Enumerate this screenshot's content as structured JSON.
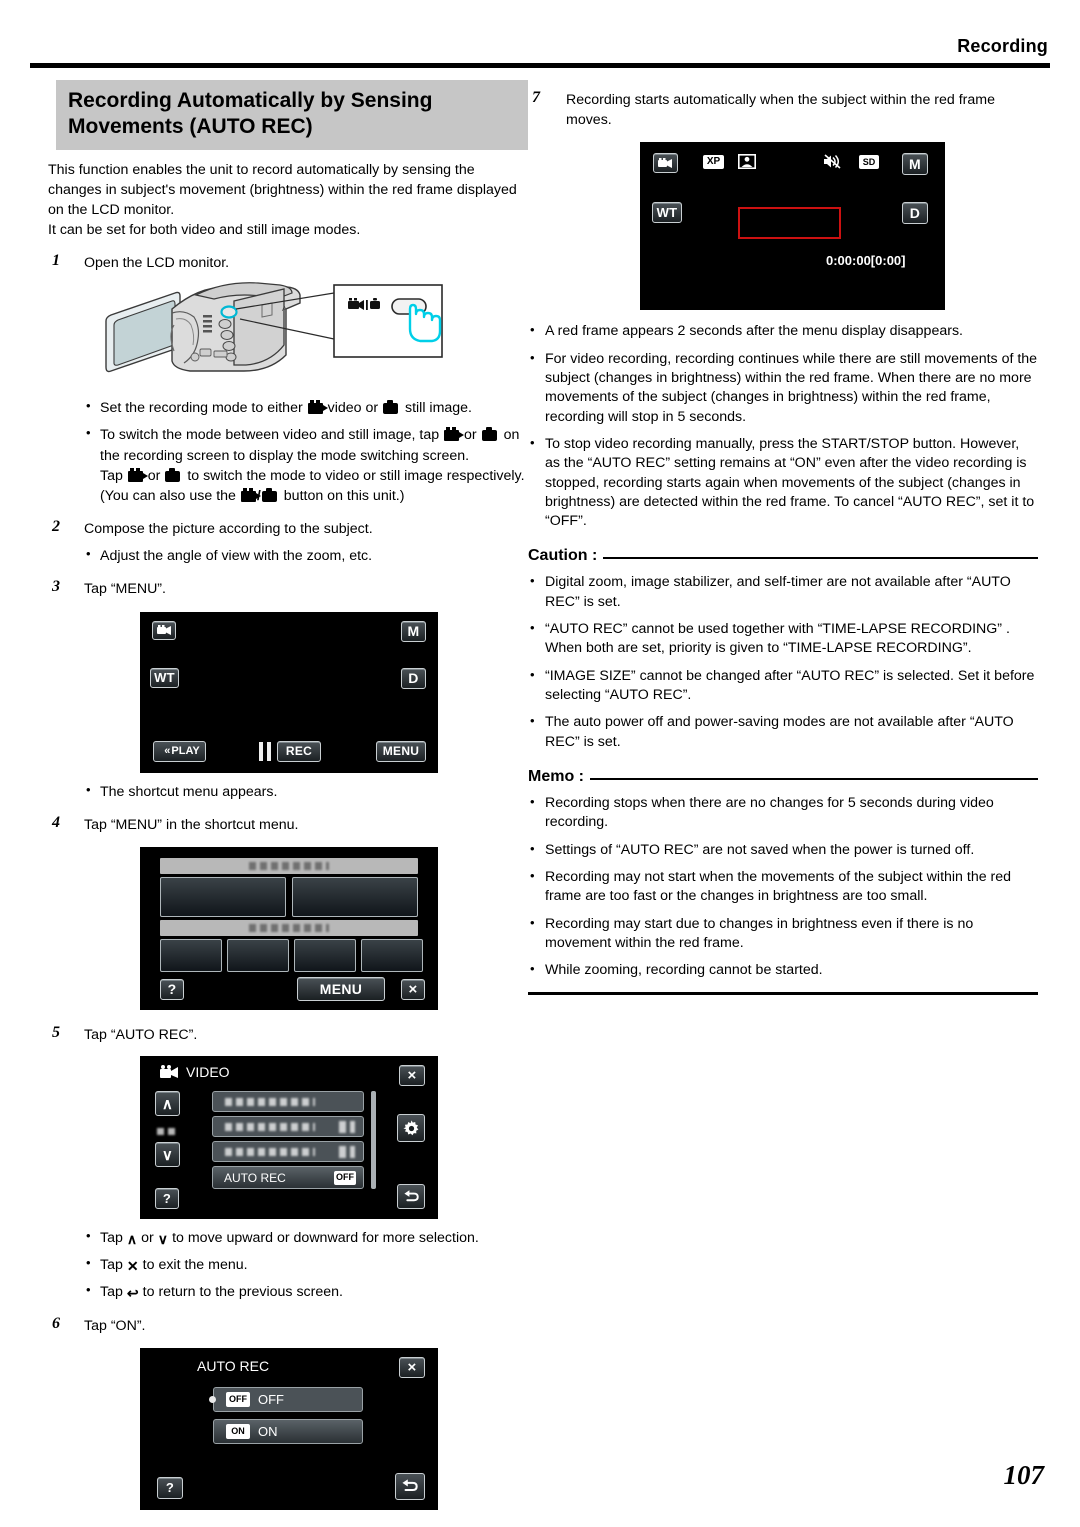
{
  "header": {
    "title": "Recording"
  },
  "page_number": "107",
  "section": {
    "title": "Recording Automatically by Sensing Movements (AUTO REC)",
    "intro_1": "This function enables the unit to record automatically by sensing the changes in subject's movement (brightness) within the red frame displayed on the LCD monitor.",
    "intro_2": "It can be set for both video and still image modes."
  },
  "steps": {
    "s1": {
      "num": "1",
      "text": "Open the LCD monitor."
    },
    "s2": {
      "num": "2",
      "text": "Compose the picture according to the subject."
    },
    "s3": {
      "num": "3",
      "text": "Tap “MENU”."
    },
    "s4": {
      "num": "4",
      "text": "Tap “MENU” in the shortcut menu."
    },
    "s5": {
      "num": "5",
      "text": "Tap “AUTO REC”."
    },
    "s6": {
      "num": "6",
      "text": "Tap “ON”."
    },
    "s7": {
      "num": "7",
      "text": "Recording starts automatically when the subject within the red frame moves."
    }
  },
  "bullets": {
    "b1_a": "Set the recording mode to either",
    "b1_b": "video or",
    "b1_c": "still image.",
    "b2_a": "To switch the mode between video and still image, tap",
    "b2_b": "or",
    "b2_c": "on the recording screen to display the mode switching screen.",
    "b2_d": "Tap",
    "b2_e": "or",
    "b2_f": "to switch the mode to video or still image respectively.",
    "b2_g": "(You can also use the",
    "b2_h": "button on this unit.)",
    "b3": "Adjust the angle of view with the zoom, etc.",
    "b4": "The shortcut menu appears.",
    "b5_a": "Tap",
    "b5_b": "or",
    "b5_c": "to move upward or downward for more selection.",
    "b6_a": "Tap",
    "b6_b": "to exit the menu.",
    "b7_a": "Tap",
    "b7_b": "to return to the previous screen."
  },
  "right_notes": {
    "n1": "A red frame appears 2 seconds after the menu display disappears.",
    "n2": "For video recording, recording continues while there are still movements of the subject (changes in brightness) within the red frame. When there are no more movements of the subject (changes in brightness) within the red frame, recording will stop in 5 seconds.",
    "n3": "To stop video recording manually, press the START/STOP button. However, as the “AUTO REC” setting remains at “ON” even after the video recording is stopped, recording starts again when movements of the subject (changes in brightness) are detected within the red frame. To cancel “AUTO REC”, set it to “OFF”."
  },
  "caution": {
    "label": "Caution :",
    "items": [
      "Digital zoom, image stabilizer, and self-timer are not available after “AUTO REC” is set.",
      "“AUTO REC” cannot be used together with “TIME-LAPSE RECORDING” . When both are set, priority is given to “TIME-LAPSE RECORDING”.",
      "“IMAGE SIZE” cannot be changed after “AUTO REC” is selected. Set it before selecting “AUTO REC”.",
      "The auto power off and power-saving modes are not available after “AUTO REC” is set."
    ]
  },
  "memo": {
    "label": "Memo :",
    "items": [
      "Recording stops when there are no changes for 5 seconds during video recording.",
      "Settings of “AUTO REC” are not saved when the power is turned off.",
      "Recording may not start when the movements of the subject within the red frame are too fast or the changes in brightness are too small.",
      "Recording may start due to changes in brightness even if there is no movement within the red frame.",
      "While zooming, recording cannot be started."
    ]
  },
  "screens": {
    "rec_screen": {
      "mode_icon": "video-camera-icon",
      "m_badge": "M",
      "wt": "WT",
      "d_badge": "D",
      "play": "PLAY",
      "rec": "REC",
      "menu": "MENU"
    },
    "shortcut_menu": {
      "help": "?",
      "menu": "MENU",
      "close": "×"
    },
    "video_menu": {
      "title": "VIDEO",
      "close": "×",
      "up": "∧",
      "down": "∨",
      "help": "?",
      "gear": "gear-icon",
      "back": "back-icon",
      "auto_rec_label": "AUTO REC",
      "auto_rec_value": "OFF"
    },
    "auto_rec_screen": {
      "title": "AUTO REC",
      "close": "×",
      "off_badge": "OFF",
      "off_label": "OFF",
      "on_badge": "ON",
      "on_label": "ON",
      "help": "?",
      "back": "back-icon"
    },
    "live_rec": {
      "mode_icon": "video-camera-icon",
      "xp": "XP",
      "person": "face-detect-icon",
      "mute": "mute-icon",
      "sd": "SD",
      "m_badge": "M",
      "wt": "WT",
      "d_badge": "D",
      "timecode": "0:00:00[0:00]",
      "frame_color": "#cc1111"
    }
  }
}
